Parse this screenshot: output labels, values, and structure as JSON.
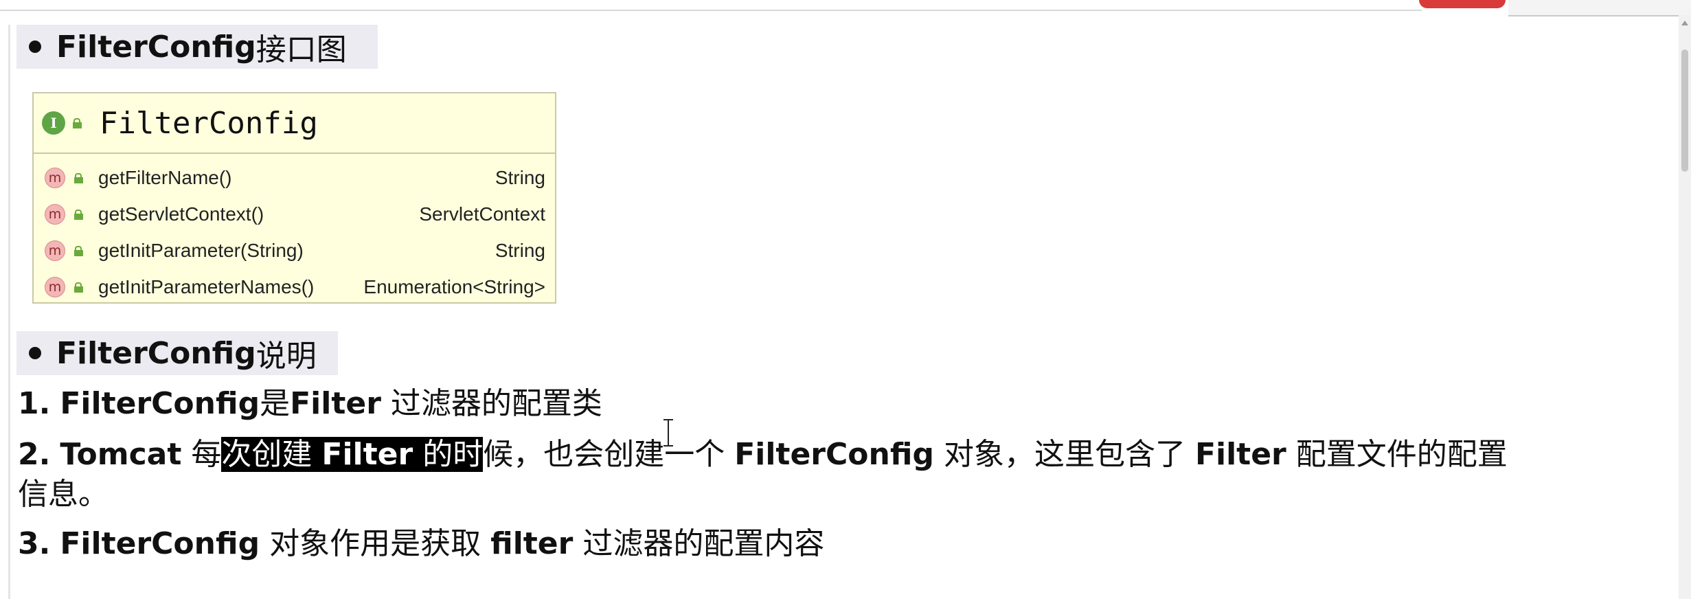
{
  "heading1": {
    "bold": "FilterConfig",
    "rest": "接口图"
  },
  "uml": {
    "interface_icon": "I",
    "title": "FilterConfig",
    "method_icon": "m",
    "methods": [
      {
        "name": "getFilterName()",
        "type": "String"
      },
      {
        "name": "getServletContext()",
        "type": "ServletContext"
      },
      {
        "name": "getInitParameter(String)",
        "type": "String"
      },
      {
        "name": "getInitParameterNames()",
        "type": "Enumeration<String>"
      }
    ]
  },
  "heading2": {
    "bold": "FilterConfig",
    "rest": "说明"
  },
  "paragraphs": {
    "p1": {
      "num": "1.",
      "a": "FilterConfig",
      "b": "是",
      "c": "Filter",
      "d": " 过滤器的配置类"
    },
    "p2": {
      "num": "2.",
      "a": "Tomcat",
      "b": " 每",
      "hl1": "次创建 ",
      "hl_bold": "Filter",
      "hl2": " 的时",
      "c": "候，也会创建一个 ",
      "d": "FilterConfig",
      "e": " 对象，这里包含了 ",
      "f": "Filter",
      "g": " 配置文件的配置",
      "line2": "信息。"
    },
    "p3": {
      "num": "3.",
      "a": "FilterConfig",
      "b": " 对象作用是获取 ",
      "c": "filter",
      "d": " 过滤器的配置内容"
    }
  },
  "colors": {
    "uml_background": "#ffffde",
    "interface_icon": "#5fa545",
    "method_icon": "#f3b6b6",
    "heading_background": "#ebebf1",
    "selection": "#000000"
  },
  "icons": {
    "interface": "interface-icon",
    "method": "method-icon",
    "visibility": "public-lock-icon",
    "cursor": "text-cursor-icon"
  }
}
